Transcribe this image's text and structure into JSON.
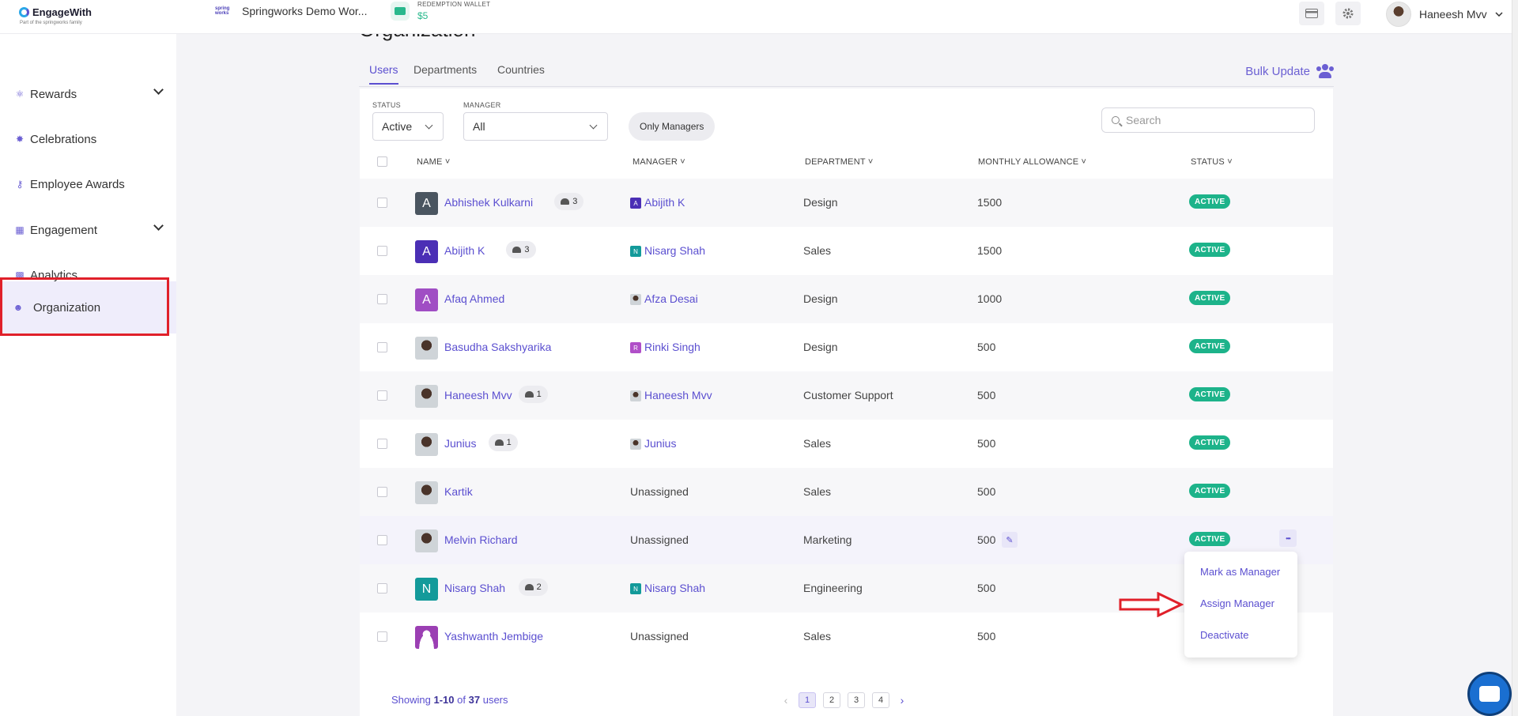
{
  "header": {
    "logo": "EngageWith",
    "logo_sub": "Part of the springworks family",
    "workspace_logo": "spring works",
    "workspace": "Springworks Demo Wor...",
    "wallet_label": "REDEMPTION WALLET",
    "wallet_amount": "$5",
    "user_name": "Haneesh Mvv",
    "icons": [
      "card-icon",
      "gear-icon",
      "chevron-down-icon"
    ]
  },
  "sidebar": {
    "items": [
      {
        "label": "Rewards",
        "icon": "medal-icon",
        "has_chevron": true
      },
      {
        "label": "Celebrations",
        "icon": "party-icon",
        "has_chevron": false
      },
      {
        "label": "Employee Awards",
        "icon": "trophy-icon",
        "has_chevron": false
      },
      {
        "label": "Engagement",
        "icon": "engagement-icon",
        "has_chevron": true
      },
      {
        "label": "Analytics",
        "icon": "bar-chart-icon",
        "has_chevron": false
      },
      {
        "label": "Organization",
        "icon": "people-icon",
        "has_chevron": false,
        "active": true
      }
    ]
  },
  "page": {
    "title": "Organization",
    "tabs": [
      "Users",
      "Departments",
      "Countries"
    ],
    "active_tab": "Users",
    "bulk_update": "Bulk Update"
  },
  "filters": {
    "status_label": "STATUS",
    "status_value": "Active",
    "manager_label": "MANAGER",
    "manager_value": "All",
    "only_managers": "Only Managers",
    "search_placeholder": "Search"
  },
  "table": {
    "columns": [
      "NAME",
      "MANAGER",
      "DEPARTMENT",
      "MONTHLY ALLOWANCE",
      "STATUS"
    ],
    "rows": [
      {
        "name": "Abhishek Kulkarni",
        "initial": "A",
        "avatar_color": "#4a5560",
        "reports": "3",
        "manager": "Abijith K",
        "manager_initial": "A",
        "manager_color": "#4b2fb5",
        "department": "Design",
        "allowance": "1500",
        "status": "ACTIVE"
      },
      {
        "name": "Abijith K",
        "initial": "A",
        "avatar_color": "#4b2fb5",
        "reports": "3",
        "manager": "Nisarg Shah",
        "manager_initial": "N",
        "manager_color": "#139a9a",
        "department": "Sales",
        "allowance": "1500",
        "status": "ACTIVE"
      },
      {
        "name": "Afaq Ahmed",
        "initial": "A",
        "avatar_color": "#a04ec4",
        "reports": "",
        "manager": "Afza Desai",
        "manager_initial": "",
        "manager_color": "photo",
        "department": "Design",
        "allowance": "1000",
        "status": "ACTIVE"
      },
      {
        "name": "Basudha Sakshyarika",
        "initial": "",
        "avatar_color": "photo",
        "reports": "",
        "manager": "Rinki Singh",
        "manager_initial": "R",
        "manager_color": "#b04fc8",
        "department": "Design",
        "allowance": "500",
        "status": "ACTIVE"
      },
      {
        "name": "Haneesh Mvv",
        "initial": "",
        "avatar_color": "photo",
        "reports": "1",
        "manager": "Haneesh Mvv",
        "manager_initial": "",
        "manager_color": "photo",
        "department": "Customer Support",
        "allowance": "500",
        "status": "ACTIVE"
      },
      {
        "name": "Junius",
        "initial": "",
        "avatar_color": "photo",
        "reports": "1",
        "manager": "Junius",
        "manager_initial": "",
        "manager_color": "photo",
        "department": "Sales",
        "allowance": "500",
        "status": "ACTIVE"
      },
      {
        "name": "Kartik",
        "initial": "",
        "avatar_color": "photo",
        "reports": "",
        "manager": "Unassigned",
        "manager_initial": "",
        "manager_color": "",
        "department": "Sales",
        "allowance": "500",
        "status": "ACTIVE"
      },
      {
        "name": "Melvin Richard",
        "initial": "",
        "avatar_color": "photo",
        "reports": "",
        "manager": "Unassigned",
        "manager_initial": "",
        "manager_color": "",
        "department": "Marketing",
        "allowance": "500",
        "status": "ACTIVE",
        "hovered": true
      },
      {
        "name": "Nisarg Shah",
        "initial": "N",
        "avatar_color": "#139a9a",
        "reports": "2",
        "manager": "Nisarg Shah",
        "manager_initial": "N",
        "manager_color": "#139a9a",
        "department": "Engineering",
        "allowance": "500",
        "status": ""
      },
      {
        "name": "Yashwanth Jembige",
        "initial": "",
        "avatar_color": "#9b3fb3",
        "reports": "",
        "manager": "Unassigned",
        "manager_initial": "",
        "manager_color": "",
        "department": "Sales",
        "allowance": "500",
        "status": ""
      }
    ]
  },
  "row_menu": {
    "items": [
      "Mark as Manager",
      "Assign Manager",
      "Deactivate"
    ]
  },
  "pagination": {
    "prefix": "Showing",
    "range": "1-10",
    "of": "of",
    "total": "37",
    "suffix": "users",
    "pages": [
      "1",
      "2",
      "3",
      "4"
    ],
    "current": "1"
  },
  "colors": {
    "accent": "#5b4fd0",
    "active_status": "#1db38a",
    "annotation_red": "#e0202a"
  }
}
